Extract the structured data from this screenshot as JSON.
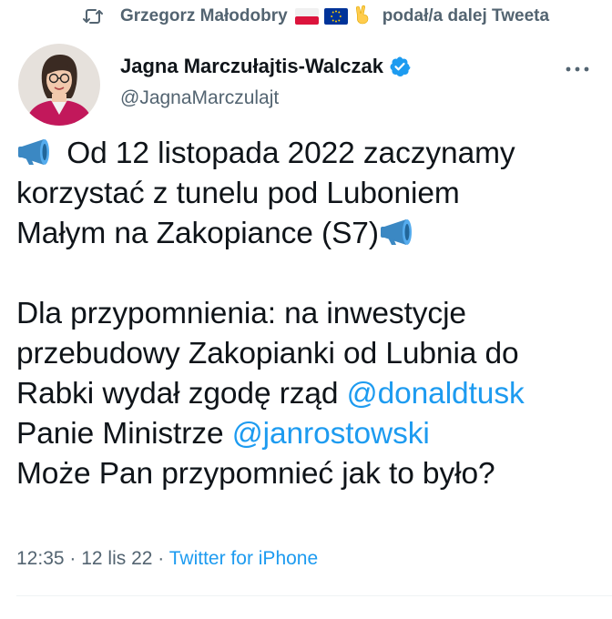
{
  "retweet": {
    "user": "Grzegorz Małodobry",
    "action": "podał/a dalej Tweeta",
    "icons": [
      "retweet-icon",
      "flag-poland",
      "flag-eu",
      "victory-hand-emoji"
    ]
  },
  "author": {
    "name": "Jagna Marczułajtis-Walczak",
    "handle": "@JagnaMarczulajt",
    "verified": true,
    "avatar": "profile-photo"
  },
  "tweet": {
    "line1_text": " Od 12 listopada 2022 zaczynamy",
    "line2": "korzystać z tunelu pod Luboniem",
    "line3_text": "Małym na Zakopiance (S7)",
    "line4": "Dla przypomnienia: na inwestycje",
    "line5": "przebudowy Zakopianki od Lubnia do",
    "line6_text": "Rabki wydał zgodę rząd ",
    "mention1": "@donaldtusk",
    "line7_text": "Panie Ministrze ",
    "mention2": "@janrostowski",
    "line8": "Może Pan przypomnieć jak to było?"
  },
  "meta": {
    "time": "12:35",
    "separator1": " · ",
    "date": "12 lis 22",
    "separator2": " · ",
    "source": "Twitter for iPhone"
  },
  "colors": {
    "link": "#1d9bf0",
    "secondary": "#536471",
    "text": "#0f1419",
    "megaphone": "#3b88c3"
  }
}
